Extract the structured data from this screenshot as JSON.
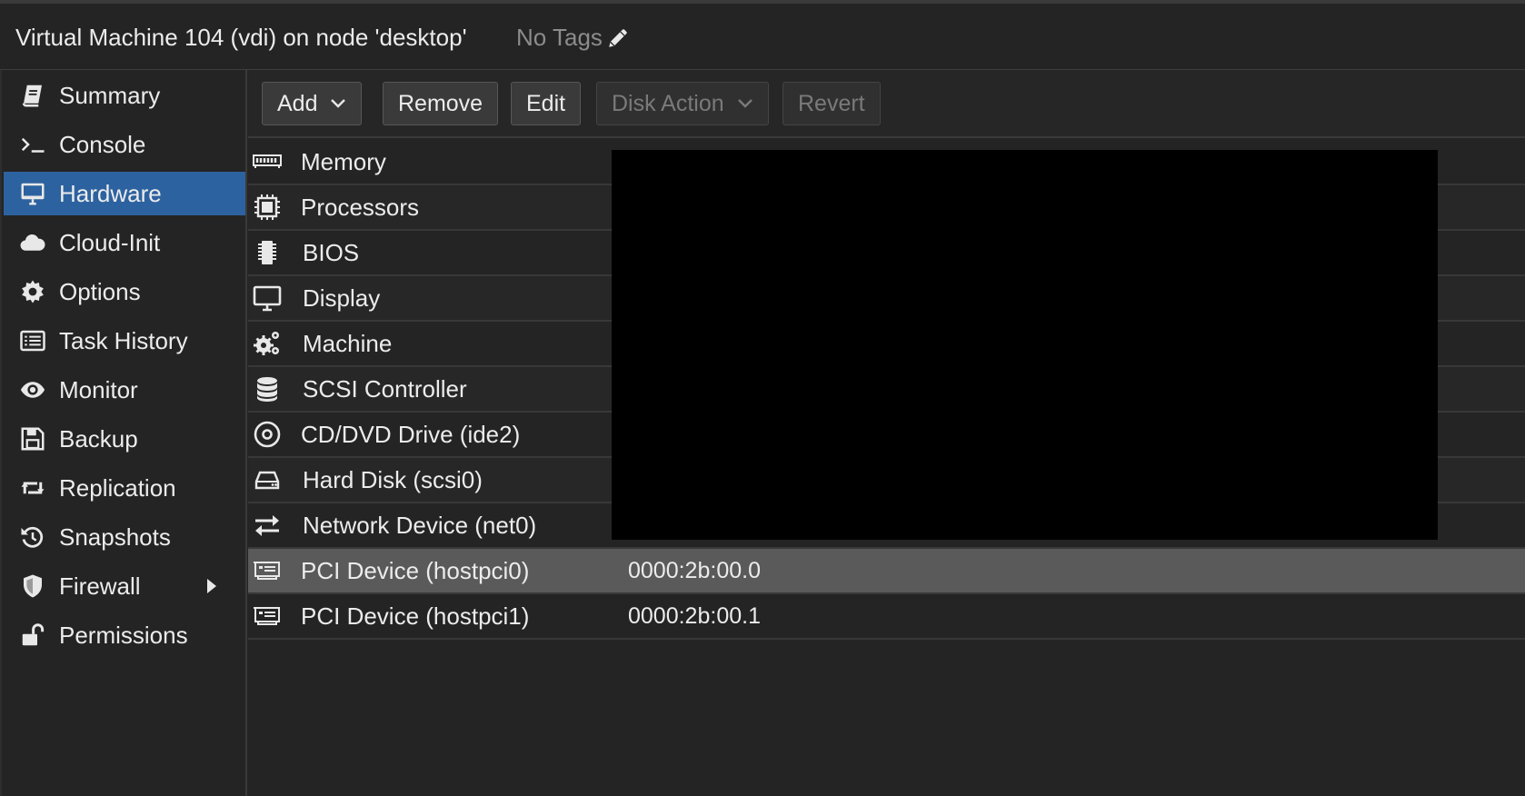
{
  "header": {
    "title": "Virtual Machine 104 (vdi) on node 'desktop'",
    "tags_label": "No Tags"
  },
  "sidebar": {
    "items": [
      {
        "label": "Summary",
        "icon": "book-icon"
      },
      {
        "label": "Console",
        "icon": "terminal-icon"
      },
      {
        "label": "Hardware",
        "icon": "desktop-icon",
        "active": true
      },
      {
        "label": "Cloud-Init",
        "icon": "cloud-icon"
      },
      {
        "label": "Options",
        "icon": "gear-icon"
      },
      {
        "label": "Task History",
        "icon": "list-icon"
      },
      {
        "label": "Monitor",
        "icon": "eye-icon"
      },
      {
        "label": "Backup",
        "icon": "floppy-icon"
      },
      {
        "label": "Replication",
        "icon": "retweet-icon"
      },
      {
        "label": "Snapshots",
        "icon": "history-icon"
      },
      {
        "label": "Firewall",
        "icon": "shield-icon",
        "expandable": true
      },
      {
        "label": "Permissions",
        "icon": "unlock-icon"
      }
    ]
  },
  "toolbar": {
    "add_label": "Add",
    "remove_label": "Remove",
    "edit_label": "Edit",
    "disk_action_label": "Disk Action",
    "revert_label": "Revert"
  },
  "hardware": {
    "rows": [
      {
        "key": "Memory",
        "value": "",
        "icon": "memory-icon"
      },
      {
        "key": "Processors",
        "value": "",
        "icon": "cpu-icon"
      },
      {
        "key": "BIOS",
        "value": "",
        "icon": "microchip-icon"
      },
      {
        "key": "Display",
        "value": "",
        "icon": "monitor-icon"
      },
      {
        "key": "Machine",
        "value": "",
        "icon": "cogs-icon"
      },
      {
        "key": "SCSI Controller",
        "value": "",
        "icon": "database-icon"
      },
      {
        "key": "CD/DVD Drive (ide2)",
        "value": "",
        "icon": "disc-icon"
      },
      {
        "key": "Hard Disk (scsi0)",
        "value": "",
        "icon": "hdd-icon"
      },
      {
        "key": "Network Device (net0)",
        "value": "",
        "icon": "exchange-icon"
      },
      {
        "key": "PCI Device (hostpci0)",
        "value": "0000:2b:00.0",
        "icon": "pci-card-icon",
        "selected": true
      },
      {
        "key": "PCI Device (hostpci1)",
        "value": "0000:2b:00.1",
        "icon": "pci-card-icon"
      }
    ]
  },
  "colors": {
    "accent": "#2d62a0",
    "background": "#242424",
    "selected_row": "#5a5a5a"
  }
}
